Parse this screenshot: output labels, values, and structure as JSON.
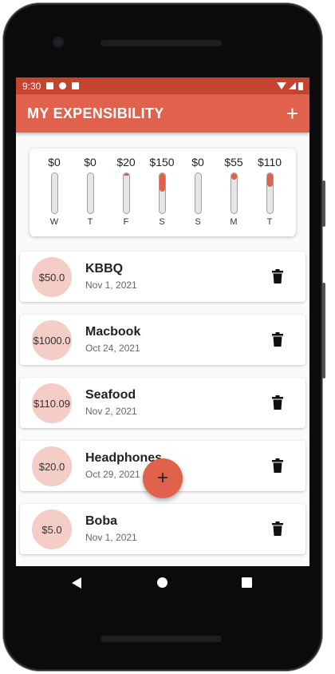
{
  "status_bar": {
    "time": "9:30"
  },
  "app_bar": {
    "title": "MY EXPENSIBILITY",
    "add_label": "+"
  },
  "chart_data": {
    "type": "bar",
    "categories": [
      "W",
      "T",
      "F",
      "S",
      "S",
      "M",
      "T"
    ],
    "labels": [
      "$0",
      "$0",
      "$20",
      "$150",
      "$0",
      "$55",
      "$110"
    ],
    "values": [
      0,
      0,
      20,
      150,
      0,
      55,
      110
    ],
    "fill_fraction": [
      0,
      0,
      0.05,
      0.45,
      0,
      0.16,
      0.33
    ],
    "colors": {
      "fill": "#e0624d",
      "track": "#e6e6e6"
    }
  },
  "expenses": [
    {
      "amount": "$50.0",
      "title": "KBBQ",
      "date": "Nov 1, 2021"
    },
    {
      "amount": "$1000.0",
      "title": "Macbook",
      "date": "Oct 24, 2021"
    },
    {
      "amount": "$110.09",
      "title": "Seafood",
      "date": "Nov 2, 2021"
    },
    {
      "amount": "$20.0",
      "title": "Headphones",
      "date": "Oct 29, 2021"
    },
    {
      "amount": "$5.0",
      "title": "Boba",
      "date": "Nov 1, 2021"
    }
  ],
  "fab": {
    "label": "+"
  },
  "icons": {
    "delete": "trash-icon",
    "add": "plus-icon",
    "nav": [
      "back-icon",
      "home-icon",
      "recent-apps-icon"
    ]
  },
  "theme": {
    "accent": "#e0624d",
    "status_bar": "#c5442f",
    "amount_circle": "#f3cdc6"
  }
}
